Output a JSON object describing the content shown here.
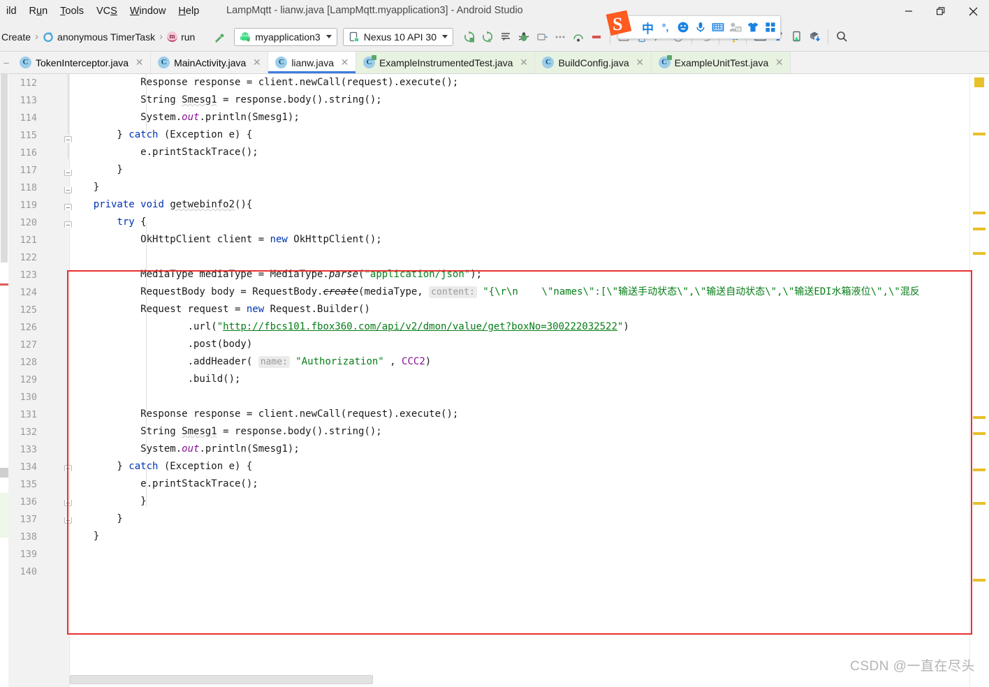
{
  "window": {
    "title": "LampMqtt - lianw.java [LampMqtt.myapplication3] - Android Studio",
    "minimize_label": "—",
    "restore_label": "❐",
    "close_label": "✕"
  },
  "menubar": {
    "items": [
      {
        "label": "ild",
        "mnemonic": "",
        "name": "menu-build"
      },
      {
        "label": "Run",
        "mnemonic": "u",
        "name": "menu-run"
      },
      {
        "label": "Tools",
        "mnemonic": "T",
        "name": "menu-tools"
      },
      {
        "label": "VCS",
        "mnemonic": "S",
        "name": "menu-vcs"
      },
      {
        "label": "Window",
        "mnemonic": "W",
        "name": "menu-window"
      },
      {
        "label": "Help",
        "mnemonic": "H",
        "name": "menu-help"
      }
    ]
  },
  "toolbar": {
    "breadcrumb": [
      {
        "label": "Create",
        "icon": ""
      },
      {
        "label": "anonymous TimerTask",
        "icon": "clock-icon"
      },
      {
        "label": "run",
        "icon": "method-icon"
      }
    ],
    "hammer_tooltip": "make-project",
    "run_config": "myapplication3",
    "device": "Nexus 10 API 30",
    "icons": [
      "rerun-icon",
      "rerun-auto-icon",
      "console-icon",
      "debug-icon",
      "stop-icon",
      "undo-icon",
      "project-structure-icon",
      "avd-manager-icon",
      "sdk-manager-icon",
      "device-manager-icon",
      "download-sdk-icon",
      "search-icon"
    ]
  },
  "sogou_ime": {
    "name": "Sogou Pinyin input method bar",
    "logo": "S",
    "items": [
      {
        "name": "language-mode-icon",
        "glyph": "中"
      },
      {
        "name": "punctuation-mode-icon",
        "glyph": "°,"
      },
      {
        "name": "emoji-icon",
        "glyph": "☺"
      },
      {
        "name": "voice-input-icon",
        "glyph": "🎤"
      },
      {
        "name": "soft-keyboard-icon",
        "glyph": "⌨"
      },
      {
        "name": "user-2d-icon",
        "glyph": "2D"
      },
      {
        "name": "skin-icon",
        "glyph": "👕"
      },
      {
        "name": "toolbox-icon",
        "glyph": "■■"
      }
    ]
  },
  "tabs": [
    {
      "label": "TokenInterceptor.java",
      "icon": "java-class-icon",
      "style": "plain",
      "active": false
    },
    {
      "label": "MainActivity.java",
      "icon": "java-class-icon",
      "style": "plain",
      "active": false
    },
    {
      "label": "lianw.java",
      "icon": "java-class-icon",
      "style": "active",
      "active": true
    },
    {
      "label": "ExampleInstrumentedTest.java",
      "icon": "java-test-class-icon",
      "style": "green",
      "active": false
    },
    {
      "label": "BuildConfig.java",
      "icon": "java-class-icon",
      "style": "green",
      "active": false
    },
    {
      "label": "ExampleUnitTest.java",
      "icon": "java-test-class-icon",
      "style": "green",
      "active": false
    }
  ],
  "tab_close_glyph": "✕",
  "editor": {
    "first_line": 112,
    "last_line": 140,
    "line_numbers": [
      112,
      113,
      114,
      115,
      116,
      117,
      118,
      119,
      120,
      121,
      122,
      123,
      124,
      125,
      126,
      127,
      128,
      129,
      130,
      131,
      132,
      133,
      134,
      135,
      136,
      137,
      138,
      139,
      140
    ],
    "lines": {
      "112": "            Response response = client.newCall(request).execute();",
      "113": "            String Smesg1 = response.body().string();",
      "114": "            System.out.println(Smesg1);",
      "115": "        } catch (Exception e) {",
      "116": "            e.printStackTrace();",
      "117": "        }",
      "118": "    }",
      "119": "    private void getwebinfo2(){",
      "120": "        try {",
      "121": "            OkHttpClient client = new OkHttpClient();",
      "122": "",
      "123": "            MediaType mediaType = MediaType.parse(\"application/json\");",
      "124": "            RequestBody body = RequestBody.create(mediaType, content: \"{\\r\\n    \\\"names\\\":[\\\"输送手动状态\\\",\\\"输送自动状态\\\",\\\"输送EDI水箱液位\\\",\\\"混反",
      "125": "            Request request = new Request.Builder()",
      "126": "                    .url(\"http://fbcs101.fbox360.com/api/v2/dmon/value/get?boxNo=300222032522\")",
      "127": "                    .post(body)",
      "128": "                    .addHeader( name: \"Authorization\" , CCC2)",
      "129": "                    .build();",
      "130": "",
      "131": "            Response response = client.newCall(request).execute();",
      "132": "            String Smesg1 = response.body().string();",
      "133": "            System.out.println(Smesg1);",
      "134": "        } catch (Exception e) {",
      "135": "            e.printStackTrace();",
      "136": "            }",
      "137": "        }",
      "138": "    }",
      "139": "",
      "140": ""
    },
    "url_text": "http://fbcs101.fbox360.com/api/v2/dmon/value/get?boxNo=300222032522",
    "param_hint_content": "content:",
    "param_hint_name": "name:",
    "json_string_chinese": "\\\"names\\\":[\\\"输送手动状态\\\",\\\"输送自动状态\\\",\\\"输送EDI水箱液位\\\",\\\"混反"
  },
  "annotation": {
    "name": "red-highlight-rectangle",
    "color": "#e8312f",
    "covers_lines": "119-139"
  },
  "markers": {
    "warning_color": "#e8c029",
    "error_color": "#e05a5a",
    "positions": [
      34,
      190,
      320,
      370,
      845
    ]
  },
  "watermark": "CSDN @一直在尽头",
  "colors": {
    "keyword": "#0033b3",
    "string": "#067d17",
    "number": "#1750eb",
    "static_field": "#871094",
    "accent_tab": "#3b7ddd",
    "annotation_red": "#e8312f",
    "ime_orange": "#ff5a1f",
    "ime_blue": "#1a82e2"
  }
}
